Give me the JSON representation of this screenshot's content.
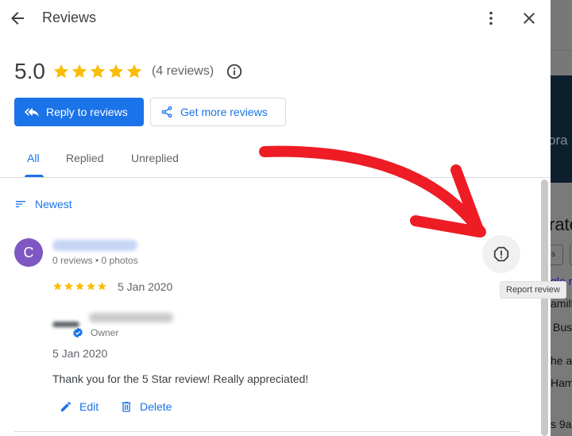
{
  "header": {
    "title": "Reviews",
    "back_icon": "arrow-left-icon",
    "more_icon": "more-vert-icon",
    "close_icon": "close-icon"
  },
  "summary": {
    "rating": "5.0",
    "stars": 5,
    "count_label": "(4 reviews)",
    "info_icon": "info-icon"
  },
  "actions": {
    "reply_label": "Reply to reviews",
    "get_more_label": "Get more reviews"
  },
  "tabs": [
    {
      "label": "All",
      "active": true
    },
    {
      "label": "Replied",
      "active": false
    },
    {
      "label": "Unreplied",
      "active": false
    }
  ],
  "sort": {
    "label": "Newest",
    "icon": "sort-icon"
  },
  "review": {
    "avatar_initial": "C",
    "avatar_color": "#7e57c2",
    "reviewer_name": "",
    "meta": "0 reviews • 0 photos",
    "stars": 5,
    "date": "5 Jan 2020",
    "report_tooltip": "Report review",
    "reply": {
      "owner_label": "Owner",
      "date": "5 Jan 2020",
      "text": "Thank you for the 5 Star review! Really appreciated!",
      "edit_label": "Edit",
      "delete_label": "Delete"
    }
  },
  "background_page": {
    "banner_text": "ora",
    "heading_fragment": "rate",
    "chip_fragment": "s",
    "link_fragment": "gle re",
    "lines": [
      "amilt",
      "Bus",
      "he ap",
      "Ham",
      "s 9a"
    ]
  },
  "colors": {
    "accent": "#1a73e8",
    "star": "#fbbc04",
    "annotation_arrow": "#ee1c25"
  }
}
